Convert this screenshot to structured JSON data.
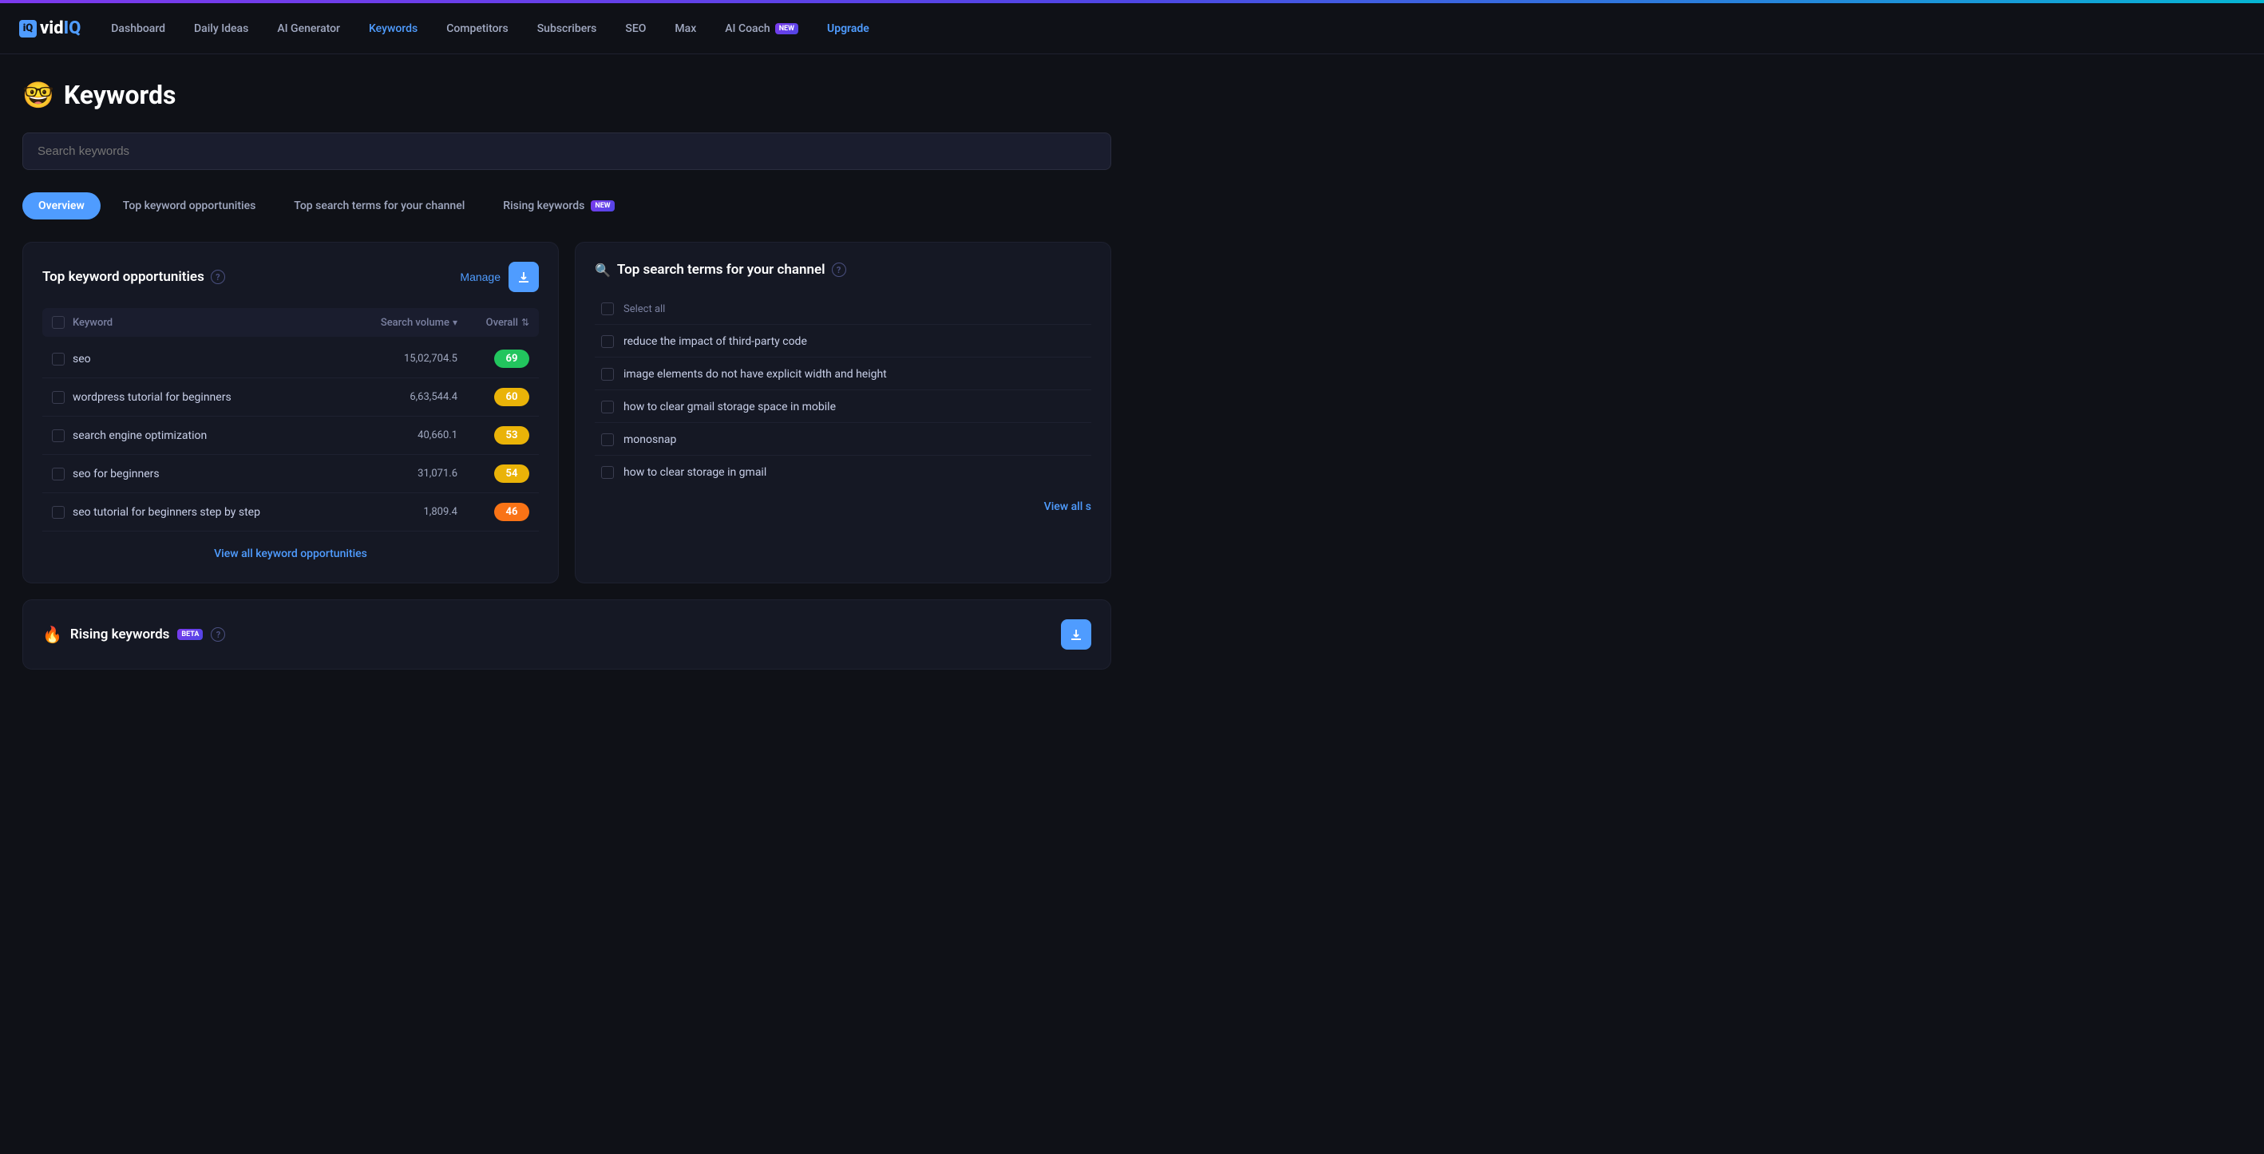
{
  "topbar": {
    "gradient": true
  },
  "nav": {
    "logo": "vidIQ",
    "items": [
      {
        "id": "dashboard",
        "label": "Dashboard",
        "active": false
      },
      {
        "id": "daily-ideas",
        "label": "Daily Ideas",
        "active": false
      },
      {
        "id": "ai-generator",
        "label": "AI Generator",
        "active": false
      },
      {
        "id": "keywords",
        "label": "Keywords",
        "active": true
      },
      {
        "id": "competitors",
        "label": "Competitors",
        "active": false
      },
      {
        "id": "subscribers",
        "label": "Subscribers",
        "active": false
      },
      {
        "id": "seo",
        "label": "SEO",
        "active": false
      },
      {
        "id": "max",
        "label": "Max",
        "active": false
      },
      {
        "id": "ai-coach",
        "label": "AI Coach",
        "active": false,
        "badge": "NEW"
      },
      {
        "id": "upgrade",
        "label": "Upgrade",
        "active": false,
        "special": true
      }
    ]
  },
  "page": {
    "emoji": "🤓",
    "title": "Keywords"
  },
  "search": {
    "placeholder": "Search keywords"
  },
  "tabs": [
    {
      "id": "overview",
      "label": "Overview",
      "active": true
    },
    {
      "id": "top-keyword-opportunities",
      "label": "Top keyword opportunities",
      "active": false
    },
    {
      "id": "top-search-terms",
      "label": "Top search terms for your channel",
      "active": false
    },
    {
      "id": "rising-keywords",
      "label": "Rising keywords",
      "active": false,
      "badge": "NEW"
    }
  ],
  "topKeywordOpportunities": {
    "title": "Top keyword opportunities",
    "manage_label": "Manage",
    "columns": {
      "keyword": "Keyword",
      "search_volume": "Search volume",
      "overall": "Overall"
    },
    "rows": [
      {
        "keyword": "seo",
        "search_volume": "15,02,704.5",
        "score": 69,
        "score_color": "green"
      },
      {
        "keyword": "wordpress tutorial for beginners",
        "search_volume": "6,63,544.4",
        "score": 60,
        "score_color": "yellow"
      },
      {
        "keyword": "search engine optimization",
        "search_volume": "40,660.1",
        "score": 53,
        "score_color": "yellow"
      },
      {
        "keyword": "seo for beginners",
        "search_volume": "31,071.6",
        "score": 54,
        "score_color": "yellow"
      },
      {
        "keyword": "seo tutorial for beginners step by step",
        "search_volume": "1,809.4",
        "score": 46,
        "score_color": "orange"
      }
    ],
    "view_all_label": "View all keyword opportunities"
  },
  "topSearchTerms": {
    "title": "Top search terms for your channel",
    "items": [
      {
        "id": "select-all",
        "label": "Select all",
        "is_header": true
      },
      {
        "id": "item-1",
        "label": "reduce the impact of third-party code"
      },
      {
        "id": "item-2",
        "label": "image elements do not have explicit width and height"
      },
      {
        "id": "item-3",
        "label": "how to clear gmail storage space in mobile"
      },
      {
        "id": "item-4",
        "label": "monosnap"
      },
      {
        "id": "item-5",
        "label": "how to clear storage in gmail"
      }
    ],
    "view_all_label": "View all s"
  },
  "risingKeywords": {
    "title": "Rising keywords",
    "badge": "BETA"
  }
}
